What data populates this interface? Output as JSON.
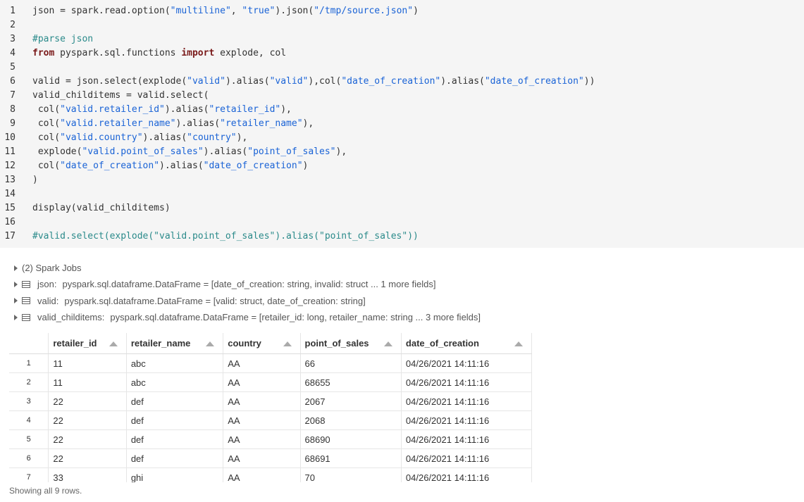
{
  "code": {
    "lines": [
      {
        "n": "1",
        "parts": [
          [
            "t",
            "json = spark.read.option("
          ],
          [
            "s",
            "\"multiline\""
          ],
          [
            "t",
            ", "
          ],
          [
            "s",
            "\"true\""
          ],
          [
            "t",
            ").json("
          ],
          [
            "s",
            "\"/tmp/source.json\""
          ],
          [
            "t",
            ")"
          ]
        ]
      },
      {
        "n": "2",
        "parts": []
      },
      {
        "n": "3",
        "parts": [
          [
            "c",
            "#parse json"
          ]
        ]
      },
      {
        "n": "4",
        "parts": [
          [
            "k",
            "from"
          ],
          [
            "t",
            " pyspark.sql.functions "
          ],
          [
            "k",
            "import"
          ],
          [
            "t",
            " explode, col"
          ]
        ]
      },
      {
        "n": "5",
        "parts": []
      },
      {
        "n": "6",
        "parts": [
          [
            "t",
            "valid = json.select(explode("
          ],
          [
            "s",
            "\"valid\""
          ],
          [
            "t",
            ").alias("
          ],
          [
            "s",
            "\"valid\""
          ],
          [
            "t",
            "),col("
          ],
          [
            "s",
            "\"date_of_creation\""
          ],
          [
            "t",
            ").alias("
          ],
          [
            "s",
            "\"date_of_creation\""
          ],
          [
            "t",
            "))"
          ]
        ]
      },
      {
        "n": "7",
        "parts": [
          [
            "t",
            "valid_childitems = valid.select("
          ]
        ]
      },
      {
        "n": "8",
        "parts": [
          [
            "t",
            " col("
          ],
          [
            "s",
            "\"valid.retailer_id\""
          ],
          [
            "t",
            ").alias("
          ],
          [
            "s",
            "\"retailer_id\""
          ],
          [
            "t",
            "),"
          ]
        ]
      },
      {
        "n": "9",
        "parts": [
          [
            "t",
            " col("
          ],
          [
            "s",
            "\"valid.retailer_name\""
          ],
          [
            "t",
            ").alias("
          ],
          [
            "s",
            "\"retailer_name\""
          ],
          [
            "t",
            "),"
          ]
        ]
      },
      {
        "n": "10",
        "parts": [
          [
            "t",
            " col("
          ],
          [
            "s",
            "\"valid.country\""
          ],
          [
            "t",
            ").alias("
          ],
          [
            "s",
            "\"country\""
          ],
          [
            "t",
            "),"
          ]
        ]
      },
      {
        "n": "11",
        "parts": [
          [
            "t",
            " explode("
          ],
          [
            "s",
            "\"valid.point_of_sales\""
          ],
          [
            "t",
            ").alias("
          ],
          [
            "s",
            "\"point_of_sales\""
          ],
          [
            "t",
            "),"
          ]
        ]
      },
      {
        "n": "12",
        "parts": [
          [
            "t",
            " col("
          ],
          [
            "s",
            "\"date_of_creation\""
          ],
          [
            "t",
            ").alias("
          ],
          [
            "s",
            "\"date_of_creation\""
          ],
          [
            "t",
            ")"
          ]
        ]
      },
      {
        "n": "13",
        "parts": [
          [
            "t",
            ")"
          ]
        ]
      },
      {
        "n": "14",
        "parts": []
      },
      {
        "n": "15",
        "parts": [
          [
            "t",
            "display(valid_childitems)"
          ]
        ]
      },
      {
        "n": "16",
        "parts": []
      },
      {
        "n": "17",
        "parts": [
          [
            "c",
            "#valid.select(explode(\"valid.point_of_sales\").alias(\"point_of_sales\"))"
          ]
        ]
      }
    ]
  },
  "output": {
    "spark_jobs": "(2) Spark Jobs",
    "dataframes": [
      {
        "name": "json:",
        "desc": "pyspark.sql.dataframe.DataFrame = [date_of_creation: string, invalid: struct ... 1 more fields]"
      },
      {
        "name": "valid:",
        "desc": "pyspark.sql.dataframe.DataFrame = [valid: struct, date_of_creation: string]"
      },
      {
        "name": "valid_childitems:",
        "desc": "pyspark.sql.dataframe.DataFrame = [retailer_id: long, retailer_name: string ... 3 more fields]"
      }
    ]
  },
  "table": {
    "columns": [
      "retailer_id",
      "retailer_name",
      "country",
      "point_of_sales",
      "date_of_creation"
    ],
    "rows": [
      {
        "n": "1",
        "cells": [
          "11",
          "abc",
          "AA",
          "66",
          "04/26/2021 14:11:16"
        ]
      },
      {
        "n": "2",
        "cells": [
          "11",
          "abc",
          "AA",
          "68655",
          "04/26/2021 14:11:16"
        ]
      },
      {
        "n": "3",
        "cells": [
          "22",
          "def",
          "AA",
          "2067",
          "04/26/2021 14:11:16"
        ]
      },
      {
        "n": "4",
        "cells": [
          "22",
          "def",
          "AA",
          "2068",
          "04/26/2021 14:11:16"
        ]
      },
      {
        "n": "5",
        "cells": [
          "22",
          "def",
          "AA",
          "68690",
          "04/26/2021 14:11:16"
        ]
      },
      {
        "n": "6",
        "cells": [
          "22",
          "def",
          "AA",
          "68691",
          "04/26/2021 14:11:16"
        ]
      },
      {
        "n": "7",
        "cells": [
          "33",
          "ghi",
          "AA",
          "70",
          "04/26/2021 14:11:16"
        ]
      }
    ]
  },
  "status": "Showing all 9 rows.",
  "colors": {
    "code_bg": "#f5f5f5",
    "string": "#1a63d6",
    "keyword": "#7a1a1a",
    "comment": "#2a8a8a"
  }
}
